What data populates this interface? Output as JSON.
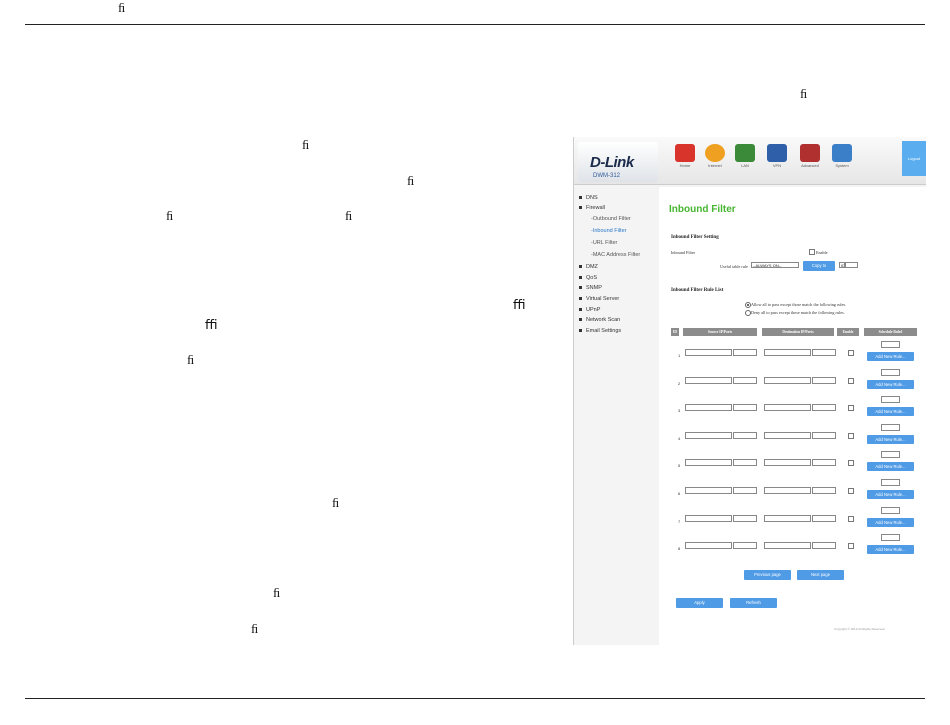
{
  "page": {
    "fragments": [
      "ﬁ",
      "ﬁ",
      "ﬁ",
      "ﬁ",
      "ﬁ",
      "ﬁ",
      "ﬃ",
      "ﬃ",
      "ﬁ",
      "ﬁ",
      "ﬁ",
      "ﬁ"
    ]
  },
  "ui": {
    "logo": "D-Link",
    "model": "DWM-312",
    "logout": "Logout",
    "nav": [
      {
        "label": "Home",
        "icon": "home-icon",
        "color": "#d9342b"
      },
      {
        "label": "Internet",
        "icon": "globe-icon",
        "color": "#f0a020"
      },
      {
        "label": "LAN",
        "icon": "lan-icon",
        "color": "#3a8a3a"
      },
      {
        "label": "VPN",
        "icon": "vpn-lock-icon",
        "color": "#2f5fa8"
      },
      {
        "label": "Advanced",
        "icon": "advanced-icon",
        "color": "#b03030"
      },
      {
        "label": "System",
        "icon": "monitor-icon",
        "color": "#3a7fc8"
      }
    ],
    "sidebar": [
      {
        "label": "DNS",
        "type": "main"
      },
      {
        "label": "Firewall",
        "type": "main"
      },
      {
        "label": "-Outbound Filter",
        "type": "sub"
      },
      {
        "label": "-Inbound Filter",
        "type": "sub",
        "active": true
      },
      {
        "label": "-URL Filter",
        "type": "sub"
      },
      {
        "label": "-MAC Address Filter",
        "type": "sub"
      },
      {
        "label": "DMZ",
        "type": "main"
      },
      {
        "label": "QoS",
        "type": "main"
      },
      {
        "label": "SNMP",
        "type": "main"
      },
      {
        "label": "Virtual Server",
        "type": "main"
      },
      {
        "label": "UPnP",
        "type": "main"
      },
      {
        "label": "Network Scan",
        "type": "main"
      },
      {
        "label": "Email Settings",
        "type": "main"
      }
    ],
    "title": "Inbound Filter",
    "setting_header": "Inbound Filter Setting",
    "filter_label": "Inbound Filter",
    "enable_label": "Enable",
    "useful_rule_label": "Useful table rule",
    "rule_select": "--ALWAYS ON--",
    "copy_button": "Copy to",
    "id_select": "ID",
    "rule_list_header": "Inbound Filter Rule List",
    "radio_allow": "Allow all to pass except those match the following rules.",
    "radio_deny": "Deny all to pass except those match the following rules.",
    "columns": [
      "ID",
      "Source IP/Ports",
      "Destination IP/Ports",
      "Enable",
      "Schedule Rule#"
    ],
    "rows": [
      "1",
      "2",
      "3",
      "4",
      "5",
      "6",
      "7",
      "8"
    ],
    "add_rule": "Add New Rule...",
    "prev_page": "Previous page",
    "next_page": "Next page",
    "apply": "Apply",
    "refresh": "Refresh",
    "copyright": "Copyright © 2012 All Rights Reserved"
  }
}
